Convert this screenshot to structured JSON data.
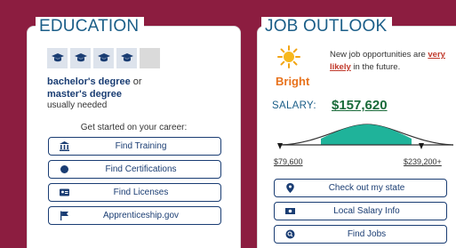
{
  "education": {
    "title": "EDUCATION",
    "degree_line1": "bachelor's degree",
    "degree_or": "or",
    "degree_line2": "master's degree",
    "needed": "usually needed",
    "started": "Get started on your career:",
    "buttons": [
      {
        "label": "Find Training",
        "icon": "building-icon"
      },
      {
        "label": "Find Certifications",
        "icon": "badge-icon"
      },
      {
        "label": "Find Licenses",
        "icon": "id-card-icon"
      },
      {
        "label": "Apprenticeship.gov",
        "icon": "flag-icon"
      }
    ],
    "caps_filled": 4,
    "caps_total": 5
  },
  "job_outlook": {
    "title": "JOB OUTLOOK",
    "rating": "Bright",
    "text_before": "New job opportunities are",
    "text_highlight": "very likely",
    "text_after": "in the future.",
    "salary_label": "SALARY:",
    "salary_value": "$157,620",
    "range_low": "$79,600",
    "range_high": "$239,200+",
    "buttons": [
      {
        "label": "Check out my state",
        "icon": "map-pin-icon"
      },
      {
        "label": "Local Salary Info",
        "icon": "money-icon"
      },
      {
        "label": "Find Jobs",
        "icon": "search-icon"
      }
    ]
  },
  "colors": {
    "background": "#8c1d40",
    "title_blue": "#1b5e88",
    "navy": "#1a3d73",
    "bright_orange": "#e8731d",
    "salary_green": "#1a6b3a",
    "curve_fill": "#1fb39a"
  }
}
